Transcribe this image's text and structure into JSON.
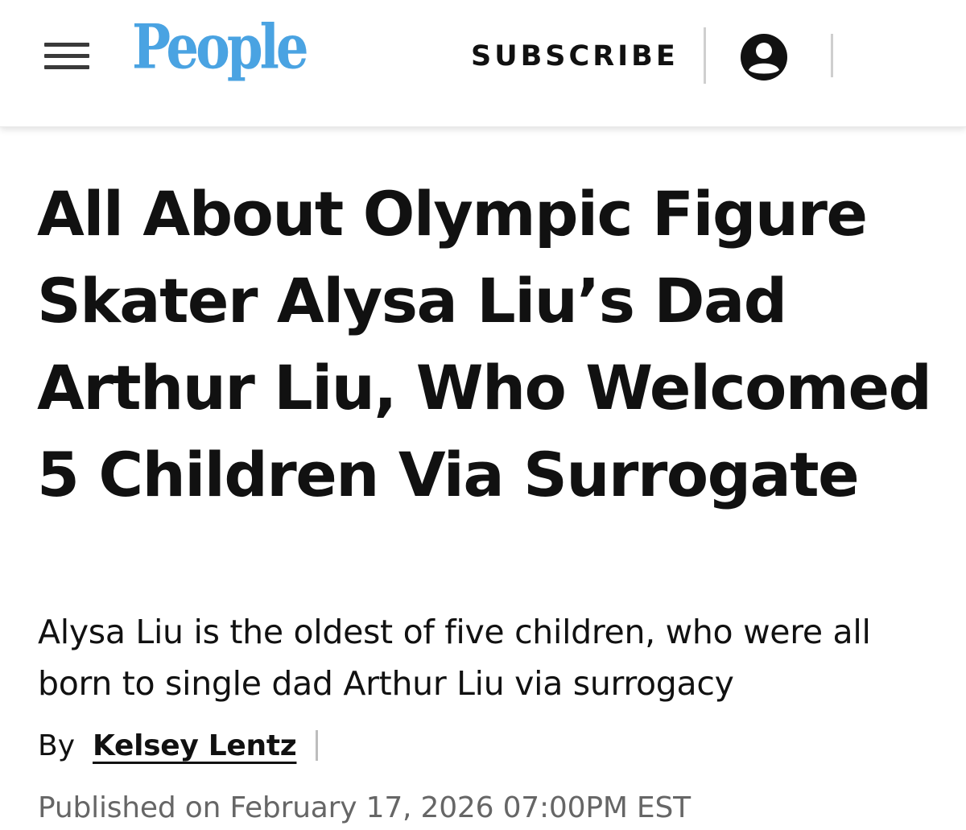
{
  "header": {
    "logo_text": "People",
    "subscribe_label": "SUBSCRIBE",
    "menu_icon": "hamburger-menu-icon",
    "account_icon": "user-account-icon",
    "brand_color": "#4aa3e2"
  },
  "article": {
    "headline": "All About Olympic Figure Skater Alysa Liu’s Dad Arthur Liu, Who Welcomed 5 Children Via Surrogate",
    "dek": "Alysa Liu is the oldest of five children, who were all born to single dad Arthur Liu via surrogacy",
    "byline_prefix": "By",
    "author": "Kelsey Lentz",
    "published": "Published on February 17, 2026 07:00PM EST"
  }
}
